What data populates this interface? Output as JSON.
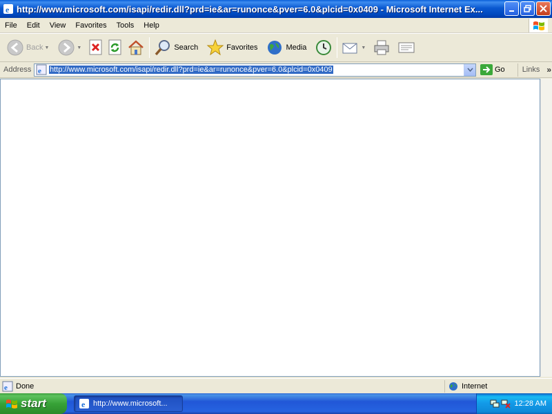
{
  "window": {
    "title": "http://www.microsoft.com/isapi/redir.dll?prd=ie&ar=runonce&pver=6.0&plcid=0x0409 - Microsoft Internet Ex..."
  },
  "menu": {
    "items": [
      "File",
      "Edit",
      "View",
      "Favorites",
      "Tools",
      "Help"
    ]
  },
  "toolbar": {
    "back_label": "Back",
    "search_label": "Search",
    "favorites_label": "Favorites",
    "media_label": "Media"
  },
  "address": {
    "label": "Address",
    "url": "http://www.microsoft.com/isapi/redir.dll?prd=ie&ar=runonce&pver=6.0&plcid=0x0409",
    "go_label": "Go",
    "links_label": "Links"
  },
  "status": {
    "text": "Done",
    "zone": "Internet"
  },
  "taskbar": {
    "start_label": "start",
    "task_label": "http://www.microsoft...",
    "clock": "12:28 AM"
  },
  "colors": {
    "titlebar": "#0a58d0",
    "selection": "#316ac5",
    "start_green": "#37a237"
  }
}
